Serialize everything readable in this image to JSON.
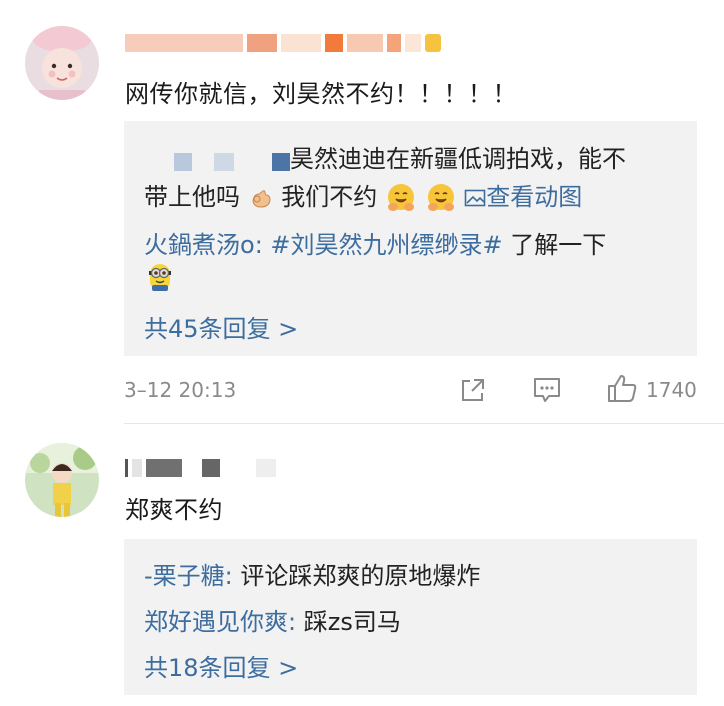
{
  "comments": [
    {
      "text": "网传你就信，刘昊然不约！！！！！",
      "replies": {
        "first": {
          "text": "昊然迪迪在新疆低调拍戏，能不",
          "text2": "带上他吗",
          "text3": "我们不约",
          "link": "查看动图"
        },
        "second": {
          "user": "火鍋煮汤o",
          "sep": ": ",
          "hashtag": "#刘昊然九州缥缈录#",
          "text": " 了解一下"
        },
        "more": "共45条回复 >"
      },
      "time": "3–12 20:13",
      "likes": "1740",
      "icons": [
        "share-icon",
        "comment-icon",
        "like-icon"
      ]
    },
    {
      "text": "郑爽不约",
      "replies": {
        "first": {
          "user": "-栗子糖",
          "sep": ": ",
          "text": "评论踩郑爽的原地爆炸"
        },
        "second": {
          "user": "郑好遇见你爽",
          "sep": ": ",
          "text": "踩zs司马"
        },
        "more": "共18条回复 >"
      }
    }
  ]
}
